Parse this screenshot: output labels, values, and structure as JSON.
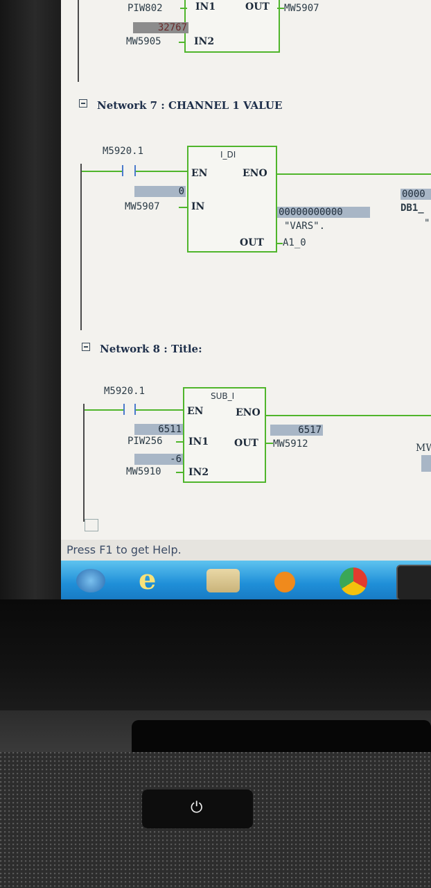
{
  "status": {
    "help_text": "Press F1 to get Help."
  },
  "network_6": {
    "in1_operand": "PIW802",
    "in1_pin": "IN1",
    "out_pin": "OUT",
    "out_operand": "MW5907",
    "in2_value": "32767",
    "in2_operand": "MW5905",
    "in2_pin": "IN2"
  },
  "network_7": {
    "heading": "Network 7 : CHANNEL 1 VALUE",
    "contact_operand": "M5920.1",
    "block_title": "I_DI",
    "en_pin": "EN",
    "eno_pin": "ENO",
    "in_value": "0",
    "in_operand": "MW5907",
    "in_pin": "IN",
    "out_value": "00000000000",
    "out_symbol": "\"VARS\".",
    "out_pin": "OUT",
    "out_operand": "A1_0",
    "right_value": "0000",
    "right_operand": "DB1_",
    "right_symbol": "\""
  },
  "network_8": {
    "heading": "Network 8 : Title:",
    "contact_operand": "M5920.1",
    "block_title": "SUB_I",
    "en_pin": "EN",
    "eno_pin": "ENO",
    "in1_value": "6511",
    "in1_operand": "PIW256",
    "in1_pin": "IN1",
    "out_pin": "OUT",
    "out_value": "6517",
    "out_operand": "MW5912",
    "in2_value": "-6",
    "in2_operand": "MW5910",
    "in2_pin": "IN2",
    "right_operand": "MW"
  },
  "taskbar": {
    "icons": [
      "windows-start-icon",
      "internet-explorer-icon",
      "file-manager-icon",
      "media-player-icon",
      "chrome-icon",
      "plc-tool-icon"
    ]
  },
  "colors": {
    "rung_green": "#4fb52b",
    "value_blue": "#a8b6c6",
    "taskbar_blue": "#1f8fd8"
  }
}
